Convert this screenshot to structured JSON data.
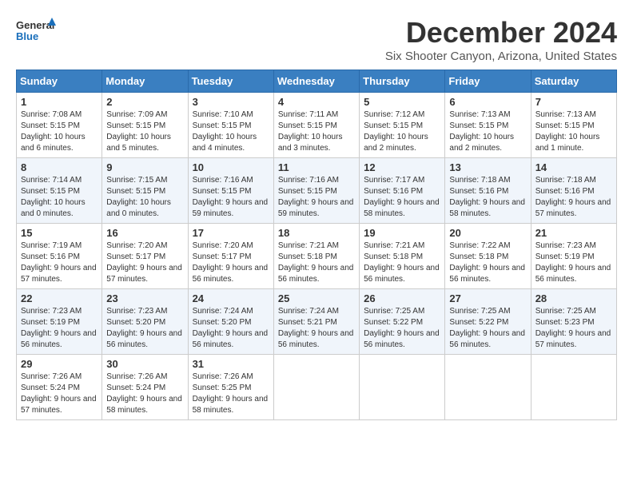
{
  "header": {
    "logo_general": "General",
    "logo_blue": "Blue",
    "month_title": "December 2024",
    "location": "Six Shooter Canyon, Arizona, United States"
  },
  "weekdays": [
    "Sunday",
    "Monday",
    "Tuesday",
    "Wednesday",
    "Thursday",
    "Friday",
    "Saturday"
  ],
  "weeks": [
    [
      {
        "day": "1",
        "sunrise": "7:08 AM",
        "sunset": "5:15 PM",
        "daylight": "10 hours and 6 minutes."
      },
      {
        "day": "2",
        "sunrise": "7:09 AM",
        "sunset": "5:15 PM",
        "daylight": "10 hours and 5 minutes."
      },
      {
        "day": "3",
        "sunrise": "7:10 AM",
        "sunset": "5:15 PM",
        "daylight": "10 hours and 4 minutes."
      },
      {
        "day": "4",
        "sunrise": "7:11 AM",
        "sunset": "5:15 PM",
        "daylight": "10 hours and 3 minutes."
      },
      {
        "day": "5",
        "sunrise": "7:12 AM",
        "sunset": "5:15 PM",
        "daylight": "10 hours and 2 minutes."
      },
      {
        "day": "6",
        "sunrise": "7:13 AM",
        "sunset": "5:15 PM",
        "daylight": "10 hours and 2 minutes."
      },
      {
        "day": "7",
        "sunrise": "7:13 AM",
        "sunset": "5:15 PM",
        "daylight": "10 hours and 1 minute."
      }
    ],
    [
      {
        "day": "8",
        "sunrise": "7:14 AM",
        "sunset": "5:15 PM",
        "daylight": "10 hours and 0 minutes."
      },
      {
        "day": "9",
        "sunrise": "7:15 AM",
        "sunset": "5:15 PM",
        "daylight": "10 hours and 0 minutes."
      },
      {
        "day": "10",
        "sunrise": "7:16 AM",
        "sunset": "5:15 PM",
        "daylight": "9 hours and 59 minutes."
      },
      {
        "day": "11",
        "sunrise": "7:16 AM",
        "sunset": "5:15 PM",
        "daylight": "9 hours and 59 minutes."
      },
      {
        "day": "12",
        "sunrise": "7:17 AM",
        "sunset": "5:16 PM",
        "daylight": "9 hours and 58 minutes."
      },
      {
        "day": "13",
        "sunrise": "7:18 AM",
        "sunset": "5:16 PM",
        "daylight": "9 hours and 58 minutes."
      },
      {
        "day": "14",
        "sunrise": "7:18 AM",
        "sunset": "5:16 PM",
        "daylight": "9 hours and 57 minutes."
      }
    ],
    [
      {
        "day": "15",
        "sunrise": "7:19 AM",
        "sunset": "5:16 PM",
        "daylight": "9 hours and 57 minutes."
      },
      {
        "day": "16",
        "sunrise": "7:20 AM",
        "sunset": "5:17 PM",
        "daylight": "9 hours and 57 minutes."
      },
      {
        "day": "17",
        "sunrise": "7:20 AM",
        "sunset": "5:17 PM",
        "daylight": "9 hours and 56 minutes."
      },
      {
        "day": "18",
        "sunrise": "7:21 AM",
        "sunset": "5:18 PM",
        "daylight": "9 hours and 56 minutes."
      },
      {
        "day": "19",
        "sunrise": "7:21 AM",
        "sunset": "5:18 PM",
        "daylight": "9 hours and 56 minutes."
      },
      {
        "day": "20",
        "sunrise": "7:22 AM",
        "sunset": "5:18 PM",
        "daylight": "9 hours and 56 minutes."
      },
      {
        "day": "21",
        "sunrise": "7:23 AM",
        "sunset": "5:19 PM",
        "daylight": "9 hours and 56 minutes."
      }
    ],
    [
      {
        "day": "22",
        "sunrise": "7:23 AM",
        "sunset": "5:19 PM",
        "daylight": "9 hours and 56 minutes."
      },
      {
        "day": "23",
        "sunrise": "7:23 AM",
        "sunset": "5:20 PM",
        "daylight": "9 hours and 56 minutes."
      },
      {
        "day": "24",
        "sunrise": "7:24 AM",
        "sunset": "5:20 PM",
        "daylight": "9 hours and 56 minutes."
      },
      {
        "day": "25",
        "sunrise": "7:24 AM",
        "sunset": "5:21 PM",
        "daylight": "9 hours and 56 minutes."
      },
      {
        "day": "26",
        "sunrise": "7:25 AM",
        "sunset": "5:22 PM",
        "daylight": "9 hours and 56 minutes."
      },
      {
        "day": "27",
        "sunrise": "7:25 AM",
        "sunset": "5:22 PM",
        "daylight": "9 hours and 56 minutes."
      },
      {
        "day": "28",
        "sunrise": "7:25 AM",
        "sunset": "5:23 PM",
        "daylight": "9 hours and 57 minutes."
      }
    ],
    [
      {
        "day": "29",
        "sunrise": "7:26 AM",
        "sunset": "5:24 PM",
        "daylight": "9 hours and 57 minutes."
      },
      {
        "day": "30",
        "sunrise": "7:26 AM",
        "sunset": "5:24 PM",
        "daylight": "9 hours and 58 minutes."
      },
      {
        "day": "31",
        "sunrise": "7:26 AM",
        "sunset": "5:25 PM",
        "daylight": "9 hours and 58 minutes."
      },
      null,
      null,
      null,
      null
    ]
  ]
}
